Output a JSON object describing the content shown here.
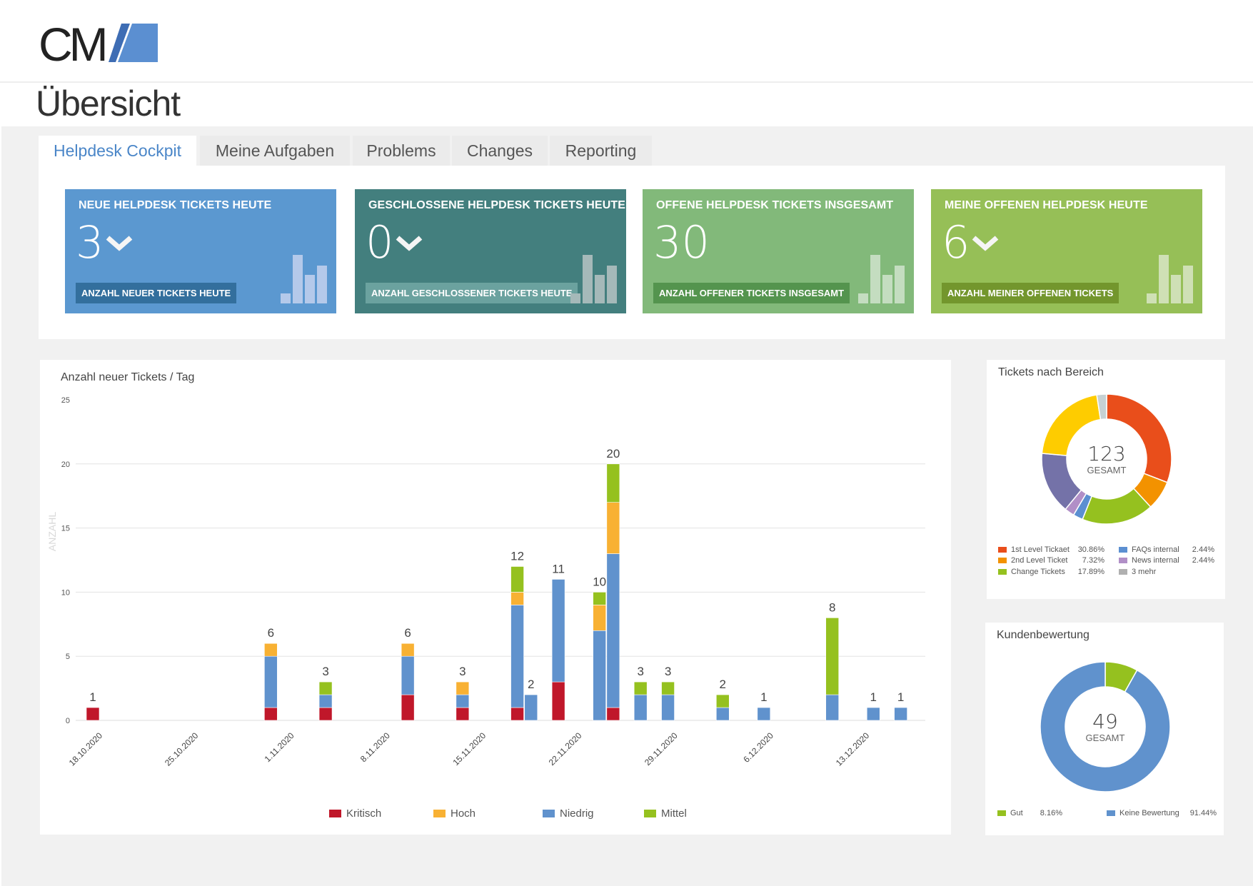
{
  "header": {
    "logo_text": "CM",
    "page_title": "Übersicht"
  },
  "tabs": [
    {
      "label": "Helpdesk Cockpit",
      "active": true
    },
    {
      "label": "Meine Aufgaben"
    },
    {
      "label": "Problems"
    },
    {
      "label": "Changes"
    },
    {
      "label": "Reporting"
    }
  ],
  "cards": [
    {
      "title": "NEUE HELPDESK TICKETS HEUTE",
      "value": "3",
      "trend": "down",
      "button": "ANZAHL NEUER TICKETS HEUTE",
      "color": "#5b98d0",
      "button_color": "#336f9d",
      "mini_color": "#b4c9ea"
    },
    {
      "title": "GESCHLOSSENE HELPDESK TICKETS HEUTE",
      "value": "0",
      "trend": "down",
      "button": "ANZAHL GESCHLOSSENER TICKETS HEUTE",
      "color": "#437f7e",
      "button_color": "#6ba29f",
      "mini_color": "#a5b9b9"
    },
    {
      "title": "OFFENE HELPDESK TICKETS INSGESAMT",
      "value": "30",
      "trend": "none",
      "button": "ANZAHL OFFENER TICKETS INSGESAMT",
      "color": "#82b97a",
      "button_color": "#54944e",
      "mini_color": "#c4ddc0"
    },
    {
      "title": "MEINE OFFENEN HELPDESK HEUTE",
      "value": "6",
      "trend": "down",
      "button": "ANZAHL MEINER OFFENEN TICKETS",
      "color": "#96bf57",
      "button_color": "#73962d",
      "mini_color": "#cfe0b5"
    }
  ],
  "chart_data": [
    {
      "type": "bar",
      "stacked": true,
      "title": "Anzahl neuer Tickets / Tag",
      "ylabel": "ANZAHL",
      "xlabel": "",
      "ylim": [
        0,
        25
      ],
      "yticks": [
        0,
        5,
        10,
        15,
        20,
        25
      ],
      "grid": true,
      "legend": "bottom",
      "xticks": [
        "18.10.2020",
        "25.10.2020",
        "1.11.2020",
        "8.11.2020",
        "15.11.2020",
        "22.11.2020",
        "29.11.2020",
        "6.12.2020",
        "13.12.2020"
      ],
      "x": [
        "18.10.2020",
        "31.10.2020",
        "4.11.2020",
        "10.11.2020",
        "14.11.2020",
        "18.11.2020",
        "19.11.2020",
        "21.11.2020",
        "24.11.2020",
        "25.11.2020",
        "27.11.2020",
        "29.11.2020",
        "3.12.2020",
        "6.12.2020",
        "11.12.2020",
        "14.12.2020",
        "16.12.2020"
      ],
      "totals": [
        1,
        6,
        3,
        6,
        3,
        12,
        2,
        11,
        10,
        20,
        3,
        3,
        2,
        1,
        8,
        1,
        1
      ],
      "series": [
        {
          "name": "Kritisch",
          "color": "#c0172a",
          "values": [
            1,
            1,
            1,
            2,
            1,
            1,
            0,
            3,
            0,
            1,
            0,
            0,
            0,
            0,
            0,
            0,
            0
          ]
        },
        {
          "name": "Niedrig",
          "color": "#6092cd",
          "values": [
            0,
            4,
            1,
            3,
            1,
            8,
            2,
            8,
            7,
            12,
            2,
            2,
            1,
            1,
            2,
            1,
            1
          ]
        },
        {
          "name": "Hoch",
          "color": "#f8b133",
          "values": [
            0,
            1,
            0,
            1,
            1,
            1,
            0,
            0,
            2,
            4,
            0,
            0,
            0,
            0,
            0,
            0,
            0
          ]
        },
        {
          "name": "Mittel",
          "color": "#95c11f",
          "values": [
            0,
            0,
            1,
            0,
            0,
            2,
            0,
            0,
            1,
            3,
            1,
            1,
            1,
            0,
            6,
            0,
            0
          ]
        }
      ],
      "legend_order": [
        "Kritisch",
        "Hoch",
        "Niedrig",
        "Mittel"
      ]
    },
    {
      "type": "pie",
      "donut": true,
      "title": "Tickets nach Bereich",
      "total": "123",
      "total_label": "GESAMT",
      "slices": [
        {
          "name": "1st Level Tickaet",
          "value": 30.86,
          "label": "30.86%",
          "color": "#e94e1b"
        },
        {
          "name": "2nd Level Ticket",
          "value": 7.32,
          "label": "7.32%",
          "color": "#f39200"
        },
        {
          "name": "Change Tickets",
          "value": 17.89,
          "label": "17.89%",
          "color": "#95c11f"
        },
        {
          "name": "FAQs internal",
          "value": 2.44,
          "label": "2.44%",
          "color": "#5b8fd1"
        },
        {
          "name": "News internal",
          "value": 2.44,
          "label": "2.44%",
          "color": "#b18fc7"
        },
        {
          "value": 15.45,
          "color": "#7472a8"
        },
        {
          "value": 21.16,
          "color": "#fecc00"
        },
        {
          "value": 2.44,
          "color": "#c6d1d3"
        }
      ],
      "more_label": "3 mehr",
      "more_color": "#b0b0b0"
    },
    {
      "type": "pie",
      "donut": true,
      "title": "Kundenbewertung",
      "total": "49",
      "total_label": "GESAMT",
      "slices": [
        {
          "name": "Gut",
          "value": 8.16,
          "label": "8.16%",
          "color": "#95c11f"
        },
        {
          "name": "Keine Bewertung",
          "value": 91.84,
          "label": "91.44%",
          "color": "#6092cd"
        }
      ]
    }
  ]
}
